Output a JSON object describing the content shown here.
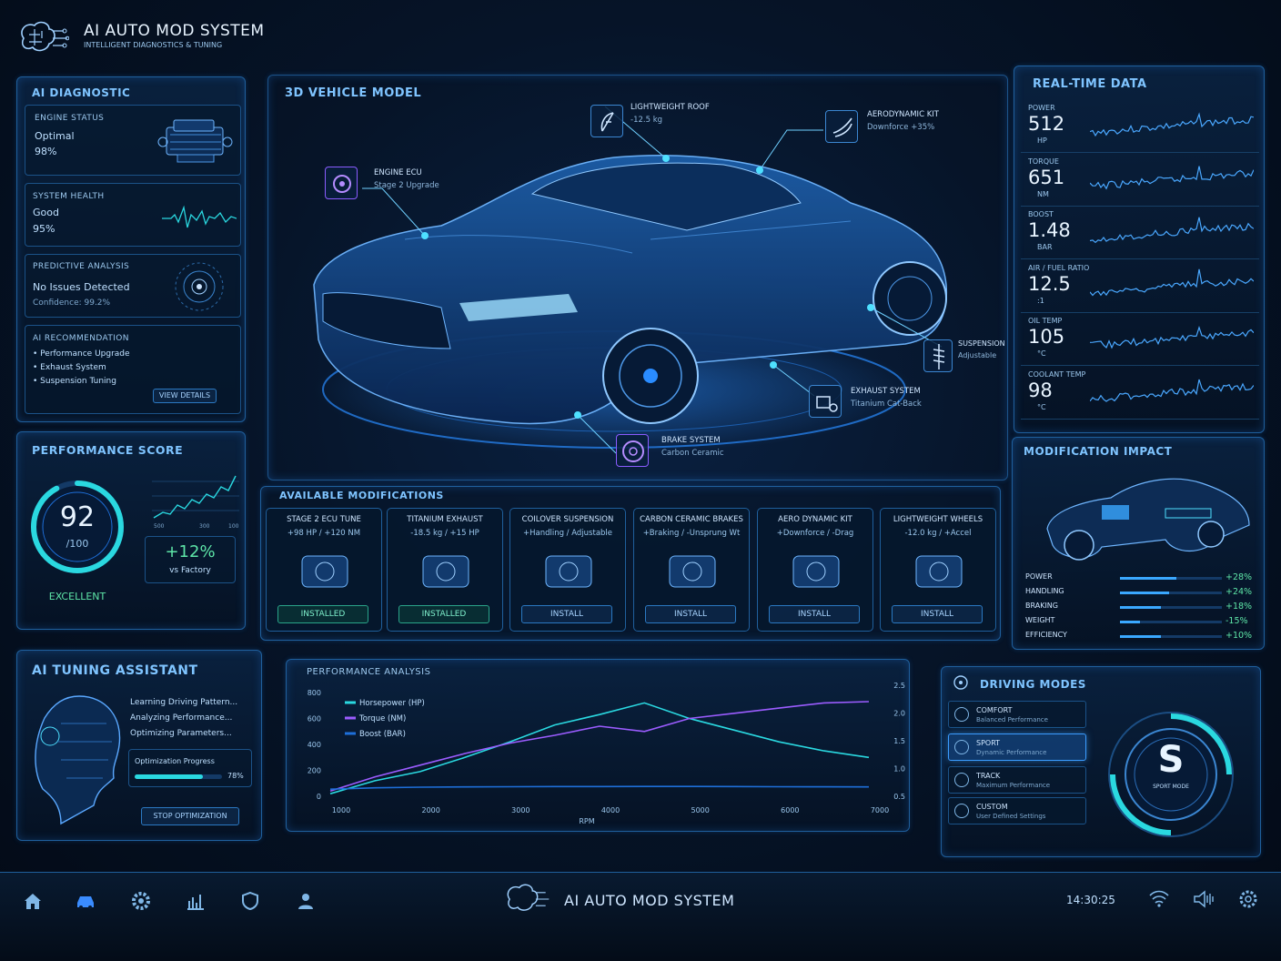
{
  "app": {
    "title": "AI AUTO MOD SYSTEM",
    "subtitle": "INTELLIGENT DIAGNOSTICS & TUNING"
  },
  "diagnostic": {
    "title": "AI DIAGNOSTIC",
    "engine": {
      "label": "ENGINE STATUS",
      "state": "Optimal",
      "pct": "98%"
    },
    "health": {
      "label": "SYSTEM HEALTH",
      "state": "Good",
      "pct": "95%"
    },
    "predictive": {
      "label": "PREDICTIVE ANALYSIS",
      "state": "No Issues Detected",
      "confidence": "Confidence: 99.2%"
    },
    "recommendation": {
      "label": "AI RECOMMENDATION",
      "items": [
        "• Performance Upgrade",
        "• Exhaust System",
        "• Suspension Tuning"
      ],
      "button": "VIEW DETAILS"
    }
  },
  "vehicle": {
    "title": "3D VEHICLE MODEL",
    "callouts": {
      "roof": {
        "name": "LIGHTWEIGHT ROOF",
        "detail": "-12.5 kg"
      },
      "aero": {
        "name": "AERODYNAMIC KIT",
        "detail": "Downforce +35%"
      },
      "ecu": {
        "name": "ENGINE ECU",
        "detail": "Stage 2 Upgrade"
      },
      "suspension": {
        "name": "SUSPENSION",
        "detail": "Adjustable"
      },
      "exhaust": {
        "name": "EXHAUST SYSTEM",
        "detail": "Titanium Cat-Back"
      },
      "brake": {
        "name": "BRAKE SYSTEM",
        "detail": "Carbon Ceramic"
      }
    }
  },
  "realtime": {
    "title": "REAL-TIME DATA",
    "rows": [
      {
        "label": "POWER",
        "value": "512",
        "unit": "HP"
      },
      {
        "label": "TORQUE",
        "value": "651",
        "unit": "NM"
      },
      {
        "label": "BOOST",
        "value": "1.48",
        "unit": "BAR"
      },
      {
        "label": "AIR / FUEL RATIO",
        "value": "12.5",
        "unit": ":1"
      },
      {
        "label": "OIL TEMP",
        "value": "105",
        "unit": "°C"
      },
      {
        "label": "COOLANT TEMP",
        "value": "98",
        "unit": "°C"
      }
    ]
  },
  "performance_score": {
    "title": "PERFORMANCE SCORE",
    "score": "92",
    "out_of": "/100",
    "rating": "EXCELLENT",
    "gain": "+12%",
    "gain_label": "vs Factory",
    "score_fraction": 0.92,
    "mini_ticks": [
      "500",
      "300",
      "100"
    ]
  },
  "modifications": {
    "title": "AVAILABLE MODIFICATIONS",
    "items": [
      {
        "name": "STAGE 2 ECU TUNE",
        "spec": "+98 HP / +120 NM",
        "button": "INSTALLED",
        "installed": true
      },
      {
        "name": "TITANIUM EXHAUST",
        "spec": "-18.5 kg / +15 HP",
        "button": "INSTALLED",
        "installed": true
      },
      {
        "name": "COILOVER SUSPENSION",
        "spec": "+Handling / Adjustable",
        "button": "INSTALL",
        "installed": false
      },
      {
        "name": "CARBON CERAMIC BRAKES",
        "spec": "+Braking / -Unsprung Wt",
        "button": "INSTALL",
        "installed": false
      },
      {
        "name": "AERO DYNAMIC KIT",
        "spec": "+Downforce / -Drag",
        "button": "INSTALL",
        "installed": false
      },
      {
        "name": "LIGHTWEIGHT WHEELS",
        "spec": "-12.0 kg / +Accel",
        "button": "INSTALL",
        "installed": false
      }
    ]
  },
  "impact": {
    "title": "MODIFICATION IMPACT",
    "rows": [
      {
        "label": "POWER",
        "value": "+28%",
        "fill": 0.55
      },
      {
        "label": "HANDLING",
        "value": "+24%",
        "fill": 0.48
      },
      {
        "label": "BRAKING",
        "value": "+18%",
        "fill": 0.4
      },
      {
        "label": "WEIGHT",
        "value": "-15%",
        "fill": 0.2
      },
      {
        "label": "EFFICIENCY",
        "value": "+10%",
        "fill": 0.4
      }
    ]
  },
  "tuning": {
    "title": "AI TUNING ASSISTANT",
    "lines": [
      "Learning Driving Pattern...",
      "Analyzing Performance...",
      "Optimizing Parameters..."
    ],
    "progress_label": "Optimization Progress",
    "progress_value": "78%",
    "progress": 0.78,
    "button": "STOP OPTIMIZATION"
  },
  "chart_data": {
    "type": "line",
    "title": "PERFORMANCE ANALYSIS",
    "xlabel": "RPM",
    "x": [
      1000,
      1500,
      2000,
      2500,
      3000,
      3500,
      4000,
      4500,
      5000,
      5500,
      6000,
      6500,
      7000
    ],
    "xticks": [
      "1000",
      "2000",
      "3000",
      "4000",
      "5000",
      "6000",
      "7000"
    ],
    "yticks_left": [
      "800",
      "600",
      "400",
      "200",
      "0"
    ],
    "yticks_right": [
      "2.5",
      "2.0",
      "1.5",
      "1.0",
      "0.5"
    ],
    "ylim_left": [
      0,
      800
    ],
    "ylim_right": [
      0.25,
      2.5
    ],
    "series": [
      {
        "name": "Horsepower (HP)",
        "axis": "left",
        "color": "#2ad8e0",
        "values": [
          20,
          120,
          190,
          300,
          420,
          550,
          630,
          720,
          600,
          510,
          420,
          350,
          300
        ]
      },
      {
        "name": "Torque (NM)",
        "axis": "left",
        "color": "#9b5cff",
        "values": [
          40,
          150,
          240,
          330,
          410,
          470,
          540,
          500,
          600,
          640,
          680,
          720,
          730
        ]
      },
      {
        "name": "Boost (BAR)",
        "axis": "left",
        "color": "#1e6fd9",
        "values": [
          55,
          65,
          70,
          72,
          74,
          75,
          75,
          76,
          76,
          75,
          74,
          73,
          72
        ]
      }
    ],
    "legend_position": "top-left"
  },
  "modes": {
    "title": "DRIVING MODES",
    "items": [
      {
        "name": "COMFORT",
        "desc": "Balanced Performance"
      },
      {
        "name": "SPORT",
        "desc": "Dynamic Performance"
      },
      {
        "name": "TRACK",
        "desc": "Maximum Performance"
      },
      {
        "name": "CUSTOM",
        "desc": "User Defined Settings"
      }
    ],
    "active_letter": "S",
    "active_label": "SPORT MODE"
  },
  "footer": {
    "title": "AI AUTO MOD SYSTEM",
    "time": "14:30:25"
  },
  "colors": {
    "accent": "#2ad8e0",
    "purple": "#9b5cff",
    "blue": "#1e6fd9",
    "installed": "#2aa58a"
  }
}
